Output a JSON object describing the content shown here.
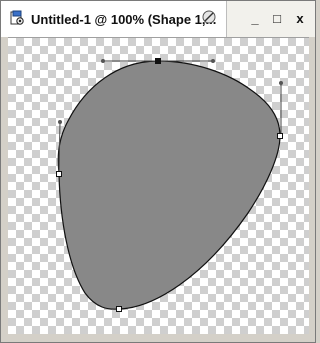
{
  "window": {
    "title": "Untitled-1 @ 100% (Shape 1,...",
    "controls": {
      "minimize": "_",
      "maximize": "□",
      "close": "x"
    }
  },
  "icons": {
    "app": "document-app-icon",
    "pin": "pin-icon"
  },
  "colors": {
    "shape_fill": "#888888",
    "shape_stroke": "#111111",
    "handle_line": "#444444",
    "checker": "#cfcfcf"
  }
}
